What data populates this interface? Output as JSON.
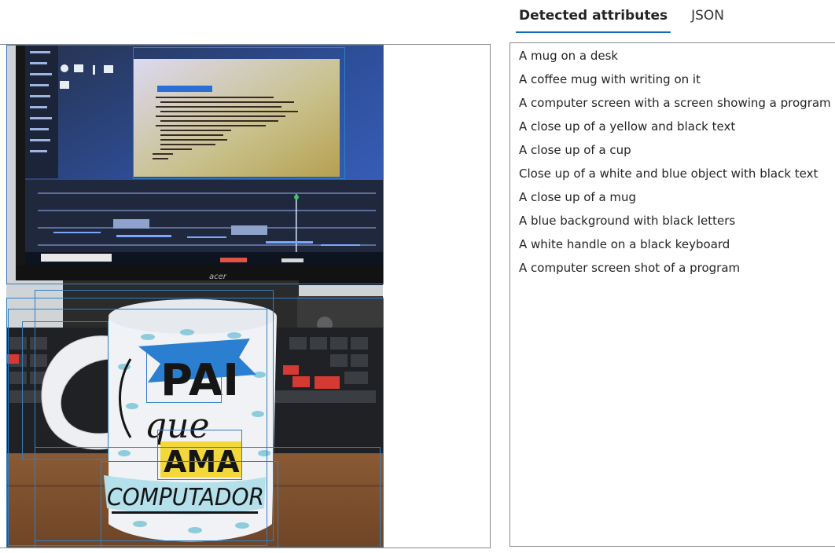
{
  "tabs": [
    {
      "label": "Detected attributes",
      "active": true
    },
    {
      "label": "JSON",
      "active": false
    }
  ],
  "attributes": [
    "A mug on a desk",
    "A coffee mug with writing on it",
    "A computer screen with a screen showing a program",
    "A close up of a yellow and black text",
    "A close up of a cup",
    "Close up of a white and blue object with black text",
    "A close up of a mug",
    "A blue background with black letters",
    "A white handle on a black keyboard",
    "A computer screen shot of a program"
  ],
  "photo": {
    "monitor_brand": "acer",
    "mug_text_line1": "PAI",
    "mug_text_line2": "que",
    "mug_text_line3": "AMA",
    "mug_text_line4": "COMPUTADOR"
  },
  "colors": {
    "accent": "#0f6cbd",
    "bbox": "#2f7fc8"
  }
}
